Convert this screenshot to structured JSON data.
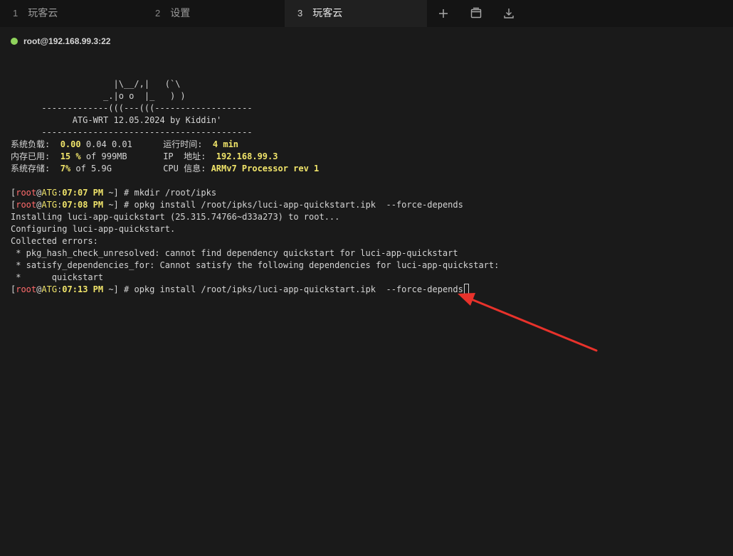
{
  "tabs": [
    {
      "num": "1",
      "label": "玩客云",
      "active": false
    },
    {
      "num": "2",
      "label": "设置",
      "active": false
    },
    {
      "num": "3",
      "label": "玩客云",
      "active": true
    }
  ],
  "toolbar": {
    "icons": [
      "plus-icon",
      "window-icon",
      "download-icon"
    ]
  },
  "connection": {
    "status_color": "#8fd35c",
    "label": "root@192.168.99.3:22"
  },
  "banner": {
    "art": [
      "                    |\\__/,|   (`\\",
      "                  _.|o o  |_   ) )",
      "      -------------(((---(((-------------------",
      "            ATG-WRT 12.05.2024 by Kiddin'",
      "      -----------------------------------------"
    ]
  },
  "sysinfo": {
    "load_label": "系统负载:",
    "load_1": "0.00",
    "load_rest": "0.04 0.01",
    "uptime_label": "运行时间:",
    "uptime_value": "4 min",
    "mem_label": "内存已用:",
    "mem_pct": "15 %",
    "mem_of": "of 999MB",
    "ip_label": "IP  地址:",
    "ip_value": "192.168.99.3",
    "disk_label": "系统存储:",
    "disk_pct": "7%",
    "disk_of": "of 5.9G",
    "cpu_label": "CPU 信息:",
    "cpu_value": "ARMv7 Processor rev 1"
  },
  "prompt": {
    "open": "[",
    "user": "root",
    "at": "@",
    "host": "ATG",
    "colon": ":",
    "close": " ~]",
    "hash": " # "
  },
  "commands": [
    {
      "time": "07:07 PM",
      "cmd": "mkdir /root/ipks"
    },
    {
      "time": "07:08 PM",
      "cmd": "opkg install /root/ipks/luci-app-quickstart.ipk  --force-depends"
    },
    {
      "time": "07:13 PM",
      "cmd": "opkg install /root/ipks/luci-app-quickstart.ipk  --force-depends"
    }
  ],
  "output": [
    "Installing luci-app-quickstart (25.315.74766~d33a273) to root...",
    "Configuring luci-app-quickstart.",
    "Collected errors:",
    " * pkg_hash_check_unresolved: cannot find dependency quickstart for luci-app-quickstart",
    " * satisfy_dependencies_for: Cannot satisfy the following dependencies for luci-app-quickstart:",
    " *      quickstart"
  ],
  "annotation": {
    "arrow_color": "#e8322b"
  }
}
